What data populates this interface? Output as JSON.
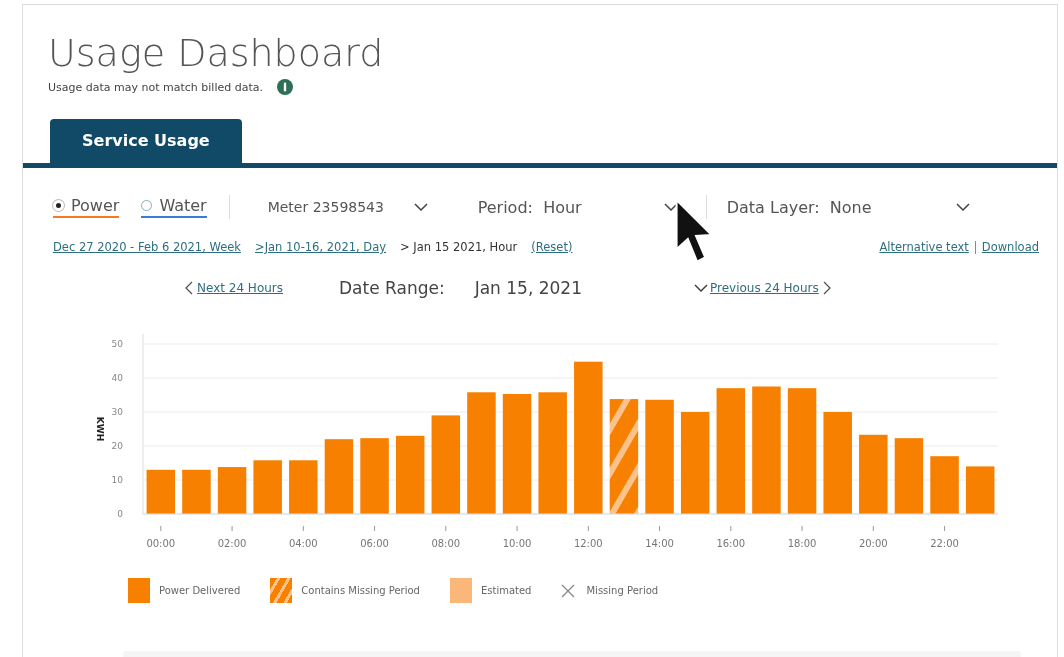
{
  "title": "Usage Dashboard",
  "subtitle": "Usage data may not match billed data.",
  "tabs": [
    {
      "label": "Service Usage",
      "selected": true
    }
  ],
  "services": [
    {
      "label": "Power",
      "selected": true,
      "color": "#f47b20"
    },
    {
      "label": "Water",
      "selected": false,
      "color": "#3a7bd5"
    }
  ],
  "meter": {
    "label": "Meter 23598543"
  },
  "period": {
    "label": "Period:",
    "value": "Hour"
  },
  "data_layer": {
    "label": "Data Layer:",
    "value": "None"
  },
  "breadcrumbs": [
    {
      "label": "Dec 27 2020 - Feb 6 2021, Week",
      "kind": "link"
    },
    {
      "label": ">Jan 10-16, 2021, Day",
      "kind": "link"
    },
    {
      "label": "> Jan 15 2021, Hour",
      "kind": "current"
    },
    {
      "label": "(Reset)",
      "kind": "link"
    }
  ],
  "links": [
    "Alternative text",
    "Download"
  ],
  "next_link": "Next 24 Hours",
  "date_range": {
    "label": "Date Range:",
    "value": "Jan 15, 2021"
  },
  "previous_link": "Previous 24 Hours",
  "chart": {
    "chart_data": {
      "type": "bar",
      "ylabel": "KWH",
      "stacked": true,
      "x": [
        0,
        1,
        2,
        3,
        4,
        5,
        6,
        7,
        8,
        9,
        10,
        11,
        12,
        13,
        14,
        15,
        16,
        17,
        18,
        19,
        20,
        21,
        22,
        23
      ],
      "xlim": [
        -0.5,
        23.5
      ],
      "grid": true,
      "ylim": [
        0,
        50
      ],
      "yticks": [
        0,
        10,
        20,
        30,
        40,
        50
      ],
      "xticks": [
        {
          "value": 0,
          "label": "00:00"
        },
        {
          "value": 2,
          "label": "02:00"
        },
        {
          "value": 4,
          "label": "04:00"
        },
        {
          "value": 6,
          "label": "06:00"
        },
        {
          "value": 8,
          "label": "08:00"
        },
        {
          "value": 10,
          "label": "10:00"
        },
        {
          "value": 12,
          "label": "12:00"
        },
        {
          "value": 14,
          "label": "14:00"
        },
        {
          "value": 16,
          "label": "16:00"
        },
        {
          "value": 18,
          "label": "18:00"
        },
        {
          "value": 20,
          "label": "20:00"
        },
        {
          "value": 22,
          "label": "22:00"
        }
      ],
      "series": [
        {
          "name": "Power Delivered",
          "color": "#f78000",
          "values": [
            13,
            13,
            13.8,
            15.8,
            15.8,
            22,
            22.3,
            23,
            29,
            35.8,
            35.3,
            35.8,
            44.8,
            null,
            33.6,
            30,
            37,
            37.5,
            37,
            30,
            23.3,
            22.3,
            17,
            14
          ]
        },
        {
          "name": "Contains Missing Period",
          "color": "#f78000",
          "values": [
            null,
            null,
            null,
            null,
            null,
            null,
            null,
            null,
            null,
            null,
            null,
            null,
            null,
            33.8,
            null,
            null,
            null,
            null,
            null,
            null,
            null,
            null,
            null,
            null
          ]
        }
      ]
    }
  },
  "legend": [
    {
      "label": "Estimated",
      "kind": "light"
    },
    {
      "label": "Missing Period",
      "kind": "cross"
    }
  ]
}
